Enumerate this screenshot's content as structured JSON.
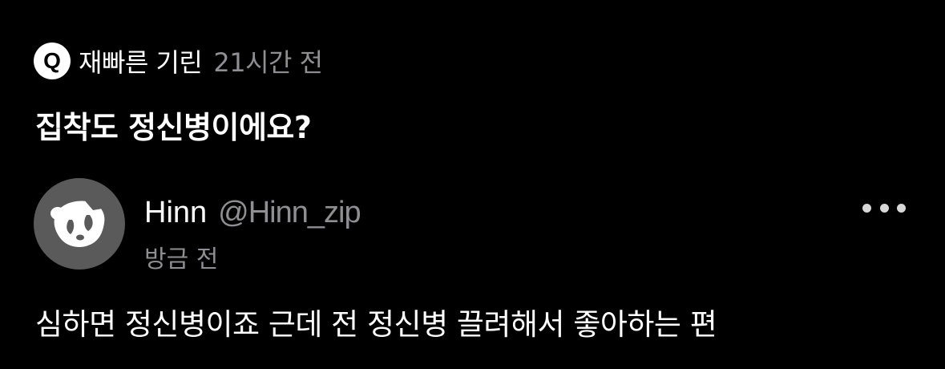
{
  "question": {
    "badge_letter": "Q",
    "asker_name": "재빠른 기린",
    "asked_time": "21시간 전",
    "text": "집착도 정신병이에요?"
  },
  "reply": {
    "avatar_icon": "panda-icon",
    "name": "Hinn",
    "handle": "@Hinn_zip",
    "time": "방금 전",
    "more_icon": "more-horizontal-icon",
    "text": "심하면 정신병이죠 근데 전 정신병 끌려해서 좋아하는 편"
  },
  "colors": {
    "background": "#000000",
    "primary_text": "#ffffff",
    "secondary_text": "#8e8e93",
    "avatar_bg": "#5a5a5a"
  }
}
